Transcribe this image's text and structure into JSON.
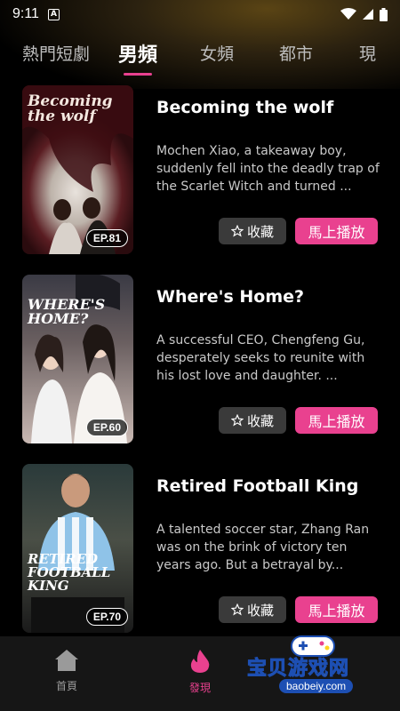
{
  "status": {
    "time": "9:11",
    "notif_icon": "A"
  },
  "tabs": [
    "熱門短劇",
    "男頻",
    "女頻",
    "都市",
    "現"
  ],
  "active_tab_index": 1,
  "cards": [
    {
      "title": "Becoming the wolf",
      "cover_text": "Becoming the wolf",
      "description": "Mochen Xiao, a takeaway boy, suddenly fell into the deadly trap of the Scarlet Witch and turned ...",
      "episodes": "EP.81",
      "fav_label": "收藏",
      "play_label": "馬上播放"
    },
    {
      "title": "Where's Home?",
      "cover_text": "WHERE'S HOME?",
      "description": "A successful CEO, Chengfeng Gu, desperately seeks to reunite with his lost love and daughter. ...",
      "episodes": "EP.60",
      "fav_label": "收藏",
      "play_label": "馬上播放"
    },
    {
      "title": "Retired Football King",
      "cover_text": "RETIRED FOOTBALL KING",
      "description": "A talented soccer star, Zhang Ran was on the brink of victory ten years ago. But a betrayal by...",
      "episodes": "EP.70",
      "fav_label": "收藏",
      "play_label": "馬上播放"
    }
  ],
  "nav": {
    "home_label": "首頁",
    "discover_label": "發現"
  },
  "watermark": {
    "text": "宝贝游戏网",
    "url": "baobeiy.com"
  },
  "colors": {
    "accent": "#e9418f",
    "background": "#000000",
    "button_secondary": "#3a3a3a"
  }
}
